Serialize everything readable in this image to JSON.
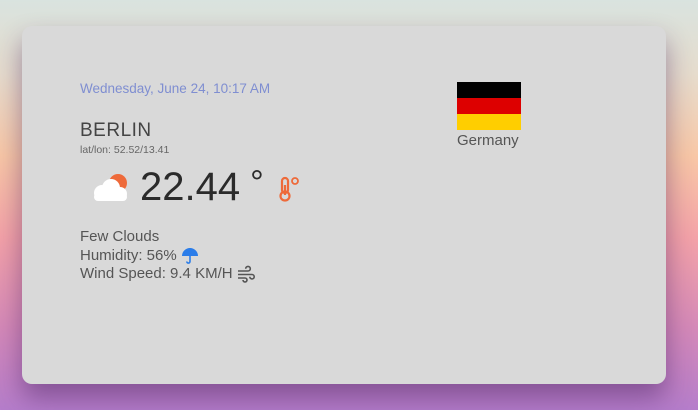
{
  "weather": {
    "date_time": "Wednesday, June 24, 10:17 AM",
    "city": "BERLIN",
    "coordinates": "lat/lon: 52.52/13.41",
    "temperature": "22.44",
    "temperature_unit": "°",
    "condition": "Few Clouds",
    "humidity": "Humidity: 56%",
    "wind_speed": "Wind Speed: 9.4 KM/H",
    "condition_icon": "cloud-sun-icon",
    "temperature_icon": "thermometer-icon",
    "humidity_icon": "umbrella-icon",
    "wind_icon": "wind-icon"
  },
  "country": {
    "name": "Germany",
    "flag_colors": [
      "#000000",
      "#dd0000",
      "#ffce00"
    ]
  },
  "colors": {
    "card_background": "#d9d9d9",
    "date_text": "#7f8ed1",
    "accent_orange": "#ee6a3a",
    "humidity_icon": "#2b7de9"
  }
}
